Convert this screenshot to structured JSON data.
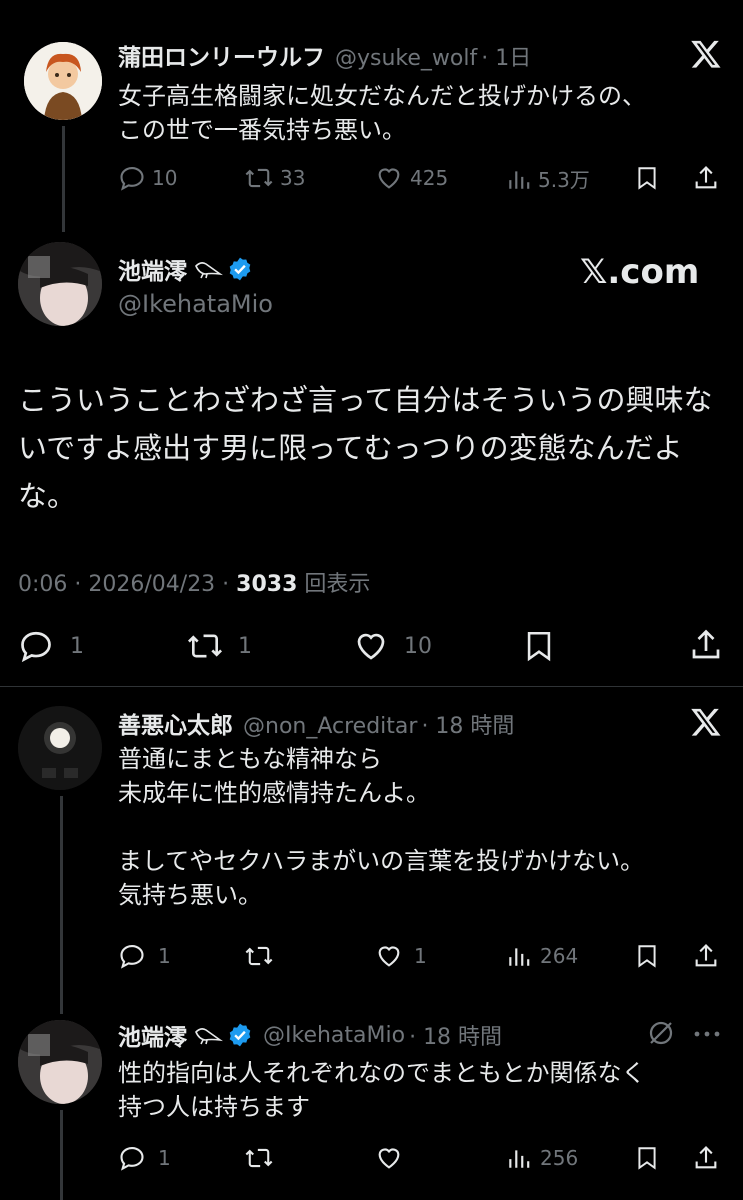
{
  "tweet1": {
    "name": "蒲田ロンリーウルフ",
    "handle": "@ysuke_wolf",
    "time": "· 1日",
    "text": "女子高生格闘家に処女だなんだと投げかけるの、\nこの世で一番気持ち悪い。",
    "replies": "10",
    "retweets": "33",
    "likes": "425",
    "views": "5.3万"
  },
  "main": {
    "name": "池端澪",
    "handle": "@IkehataMio",
    "watermark": "𝕏.com",
    "text": "こういうことわざわざ言って自分はそういうの興味ないですよ感出す男に限ってむっつりの変態なんだよな。",
    "meta_time": "0:06 · 2026/04/23 · ",
    "meta_views": "3033",
    "meta_views_label": " 回表示",
    "replies": "1",
    "retweets": "1",
    "likes": "10"
  },
  "reply1": {
    "name": "善悪心太郎",
    "handle": "@non_Acreditar",
    "time": "· 18 時間",
    "text": "普通にまともな精神なら\n未成年に性的感情持たんよ。\n\nましてやセクハラまがいの言葉を投げかけない。\n気持ち悪い。",
    "replies": "1",
    "likes": "1",
    "views": "264"
  },
  "reply2": {
    "name": "池端澪",
    "handle": "@IkehataMio",
    "time": "· 18 時間",
    "text": "性的指向は人それぞれなのでまともとか関係なく\n持つ人は持ちます",
    "replies": "1",
    "views": "256"
  },
  "colors": {
    "background": "#000000",
    "text": "#e7e9ea",
    "muted": "#71767b",
    "verified": "#1d9bf0"
  }
}
